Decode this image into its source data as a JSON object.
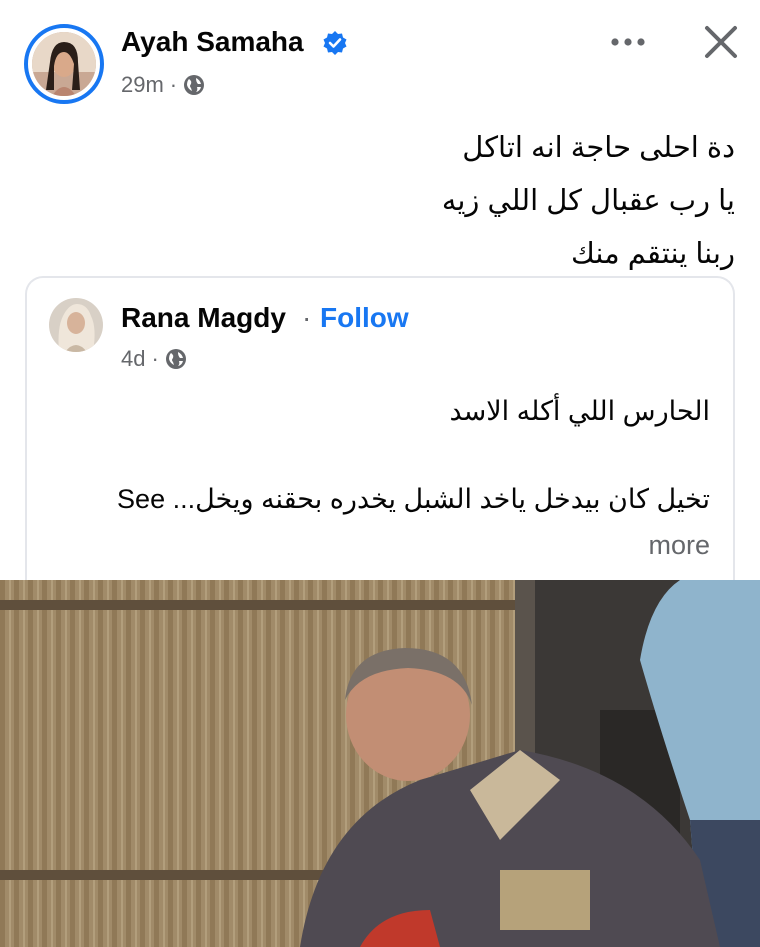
{
  "post": {
    "author": "Ayah Samaha",
    "time": "29m",
    "dot": "·",
    "text_lines": [
      "دة احلى حاجة انه اتاكل",
      "يا رب عقبال كل اللي زيه",
      "ربنا ينتقم منك"
    ]
  },
  "shared": {
    "author": "Rana Magdy",
    "dot": "·",
    "follow_label": "Follow",
    "time": "4d",
    "line1": "الحارس اللي أكله الاسد",
    "line2": "تخيل كان بيدخل ياخد الشبل يخدره بحقنه ويخل... See",
    "see_more_tail": "more"
  },
  "icons": {
    "verified": "verified-badge-icon",
    "globe": "globe-icon",
    "more": "more-options-icon",
    "close": "close-icon"
  },
  "colors": {
    "accent": "#1877f2",
    "secondary_text": "#65676b"
  }
}
